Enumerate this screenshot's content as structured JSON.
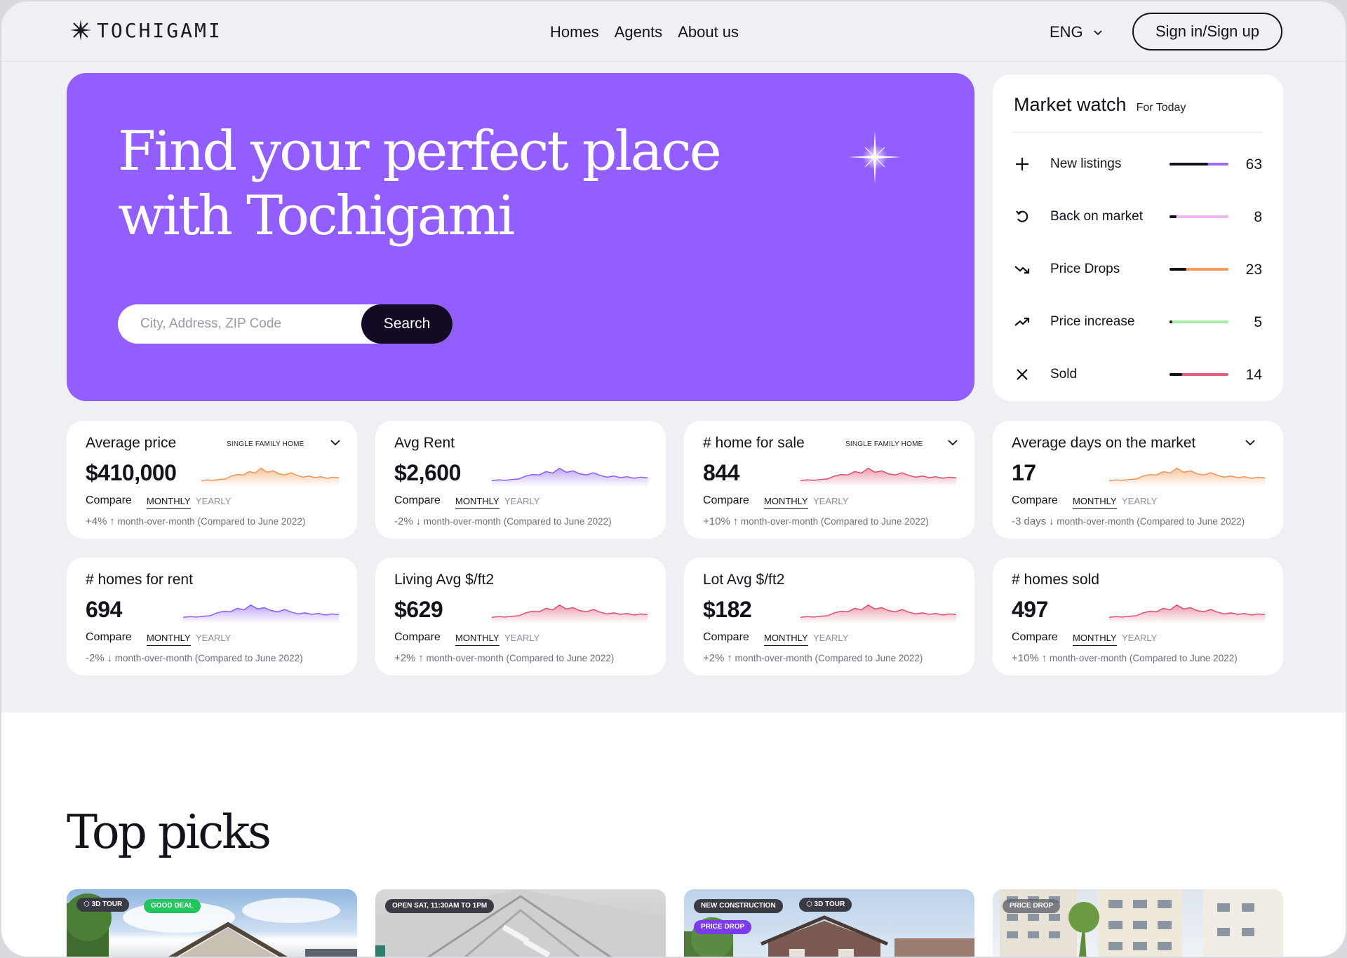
{
  "header": {
    "logo_text": "TOCHIGAMI",
    "nav": [
      "Homes",
      "Agents",
      "About us"
    ],
    "language": "ENG",
    "signin_label": "Sign in/Sign up"
  },
  "hero": {
    "title_line1": "Find your perfect place",
    "title_line2": "with Tochigami",
    "search_placeholder": "City, Address, ZIP Code",
    "search_button": "Search",
    "accent_color": "#925eff"
  },
  "market_watch": {
    "title": "Market watch",
    "subtitle": "For Today",
    "items": [
      {
        "label": "New listings",
        "value": "63",
        "icon": "plus-icon",
        "track_color": "#9a6cf7",
        "fill_fraction": 0.65
      },
      {
        "label": "Back on market",
        "value": "8",
        "icon": "undo-icon",
        "track_color": "#efb7ef",
        "fill_fraction": 0.12
      },
      {
        "label": "Price Drops",
        "value": "23",
        "icon": "trend-down-icon",
        "track_color": "#f89a5a",
        "fill_fraction": 0.28
      },
      {
        "label": "Price increase",
        "value": "5",
        "icon": "trend-up-icon",
        "track_color": "#a6eba7",
        "fill_fraction": 0.05
      },
      {
        "label": "Sold",
        "value": "14",
        "icon": "close-icon",
        "track_color": "#e0627e",
        "fill_fraction": 0.22
      }
    ]
  },
  "stats": [
    {
      "title": "Average price",
      "badge": "SINGLE FAMILY HOME",
      "has_dropdown": true,
      "value": "$410,000",
      "compare": "Compare",
      "monthly": "MONTHLY",
      "yearly": "YEARLY",
      "delta": "+4%",
      "arrow": "↑",
      "delta_text": "month-over-month (Compared to June 2022)",
      "spark_color": "#f5934f"
    },
    {
      "title": "Avg Rent",
      "badge": "",
      "has_dropdown": false,
      "value": "$2,600",
      "compare": "Compare",
      "monthly": "MONTHLY",
      "yearly": "YEARLY",
      "delta": "-2%",
      "arrow": "↓",
      "delta_text": "month-over-month (Compared to June 2022)",
      "spark_color": "#8b5cf6"
    },
    {
      "title": "# home for sale",
      "badge": "SINGLE FAMILY HOME",
      "has_dropdown": true,
      "value": "844",
      "compare": "Compare",
      "monthly": "MONTHLY",
      "yearly": "YEARLY",
      "delta": "+10%",
      "arrow": "↑",
      "delta_text": "month-over-month (Compared to June 2022)",
      "spark_color": "#dc4f6c"
    },
    {
      "title": "Average days on the market",
      "badge": "",
      "has_dropdown": true,
      "value": "17",
      "compare": "Compare",
      "monthly": "MONTHLY",
      "yearly": "YEARLY",
      "delta": "-3 days",
      "arrow": "↓",
      "delta_text": "month-over-month (Compared to June 2022)",
      "spark_color": "#f5934f"
    },
    {
      "title": "# homes for rent",
      "badge": "",
      "has_dropdown": false,
      "value": "694",
      "compare": "Compare",
      "monthly": "MONTHLY",
      "yearly": "YEARLY",
      "delta": "-2%",
      "arrow": "↓",
      "delta_text": "month-over-month (Compared to June 2022)",
      "spark_color": "#8b5cf6"
    },
    {
      "title": "Living Avg $/ft2",
      "badge": "",
      "has_dropdown": false,
      "value": "$629",
      "compare": "Compare",
      "monthly": "MONTHLY",
      "yearly": "YEARLY",
      "delta": "+2%",
      "arrow": "↑",
      "delta_text": "month-over-month (Compared to June 2022)",
      "spark_color": "#dc4f6c"
    },
    {
      "title": "Lot Avg $/ft2",
      "badge": "",
      "has_dropdown": false,
      "value": "$182",
      "compare": "Compare",
      "monthly": "MONTHLY",
      "yearly": "YEARLY",
      "delta": "+2%",
      "arrow": "↑",
      "delta_text": "month-over-month (Compared to June 2022)",
      "spark_color": "#dc4f6c"
    },
    {
      "title": "# homes sold",
      "badge": "",
      "has_dropdown": false,
      "value": "497",
      "compare": "Compare",
      "monthly": "MONTHLY",
      "yearly": "YEARLY",
      "delta": "+10%",
      "arrow": "↑",
      "delta_text": "month-over-month (Compared to June 2022)",
      "spark_color": "#dc4f6c"
    }
  ],
  "top_picks": {
    "title": "Top picks",
    "cards": [
      {
        "tags": [
          {
            "text": "3D TOUR",
            "color": "#3a3a44",
            "icon": "cube-icon"
          },
          {
            "text": "GOOD DEAL",
            "color": "#22c55e"
          }
        ]
      },
      {
        "tags": [
          {
            "text": "OPEN SAT, 11:30AM TO 1PM",
            "color": "#3a3a44"
          }
        ]
      },
      {
        "tags": [
          {
            "text": "NEW CONSTRUCTION",
            "color": "#3a3a44"
          },
          {
            "text": "3D TOUR",
            "color": "#3a3a44",
            "icon": "cube-icon"
          },
          {
            "text": "PRICE DROP",
            "color": "#7c3aed"
          }
        ]
      },
      {
        "tags": [
          {
            "text": "PRICE DROP",
            "color": "#6b6b74"
          }
        ]
      }
    ]
  }
}
